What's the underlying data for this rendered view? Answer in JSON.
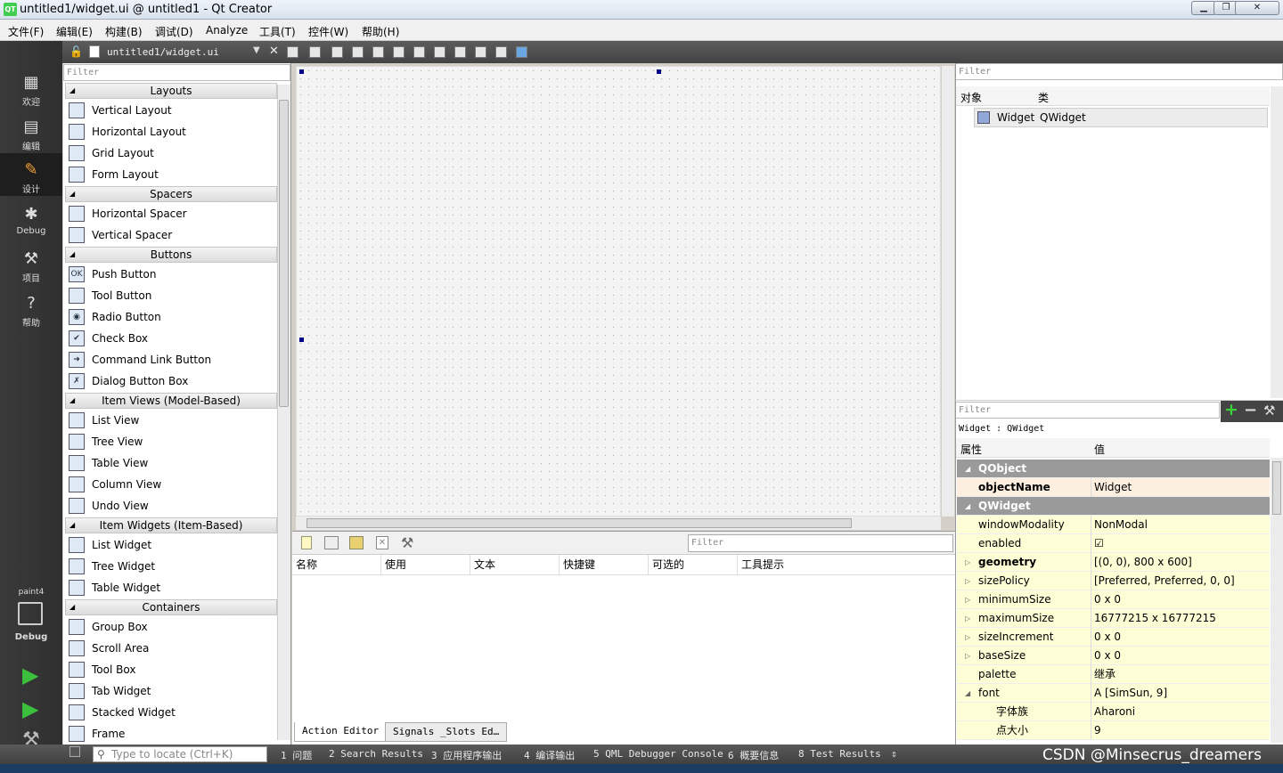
{
  "window": {
    "app_icon": "QT",
    "title": "untitled1/widget.ui @ untitled1 - Qt Creator"
  },
  "menu": [
    "文件(F)",
    "编辑(E)",
    "构建(B)",
    "调试(D)",
    "Analyze",
    "工具(T)",
    "控件(W)",
    "帮助(H)"
  ],
  "modes": [
    {
      "label": "欢迎",
      "icon": "grid-icon"
    },
    {
      "label": "编辑",
      "icon": "edit-doc-icon"
    },
    {
      "label": "设计",
      "icon": "pencil-icon"
    },
    {
      "label": "Debug",
      "icon": "bug-icon"
    },
    {
      "label": "项目",
      "icon": "wrench-icon"
    },
    {
      "label": "帮助",
      "icon": "help-icon"
    }
  ],
  "kit": {
    "project": "paint4",
    "build": "Debug"
  },
  "toolbar": {
    "file_name": "untitled1/widget.ui"
  },
  "widgetbox": {
    "filter_placeholder": "Filter",
    "sections": [
      {
        "title": "Layouts",
        "items": [
          "Vertical Layout",
          "Horizontal Layout",
          "Grid Layout",
          "Form Layout"
        ]
      },
      {
        "title": "Spacers",
        "items": [
          "Horizontal Spacer",
          "Vertical Spacer"
        ]
      },
      {
        "title": "Buttons",
        "items": [
          "Push Button",
          "Tool Button",
          "Radio Button",
          "Check Box",
          "Command Link Button",
          "Dialog Button Box"
        ]
      },
      {
        "title": "Item Views (Model-Based)",
        "items": [
          "List View",
          "Tree View",
          "Table View",
          "Column View",
          "Undo View"
        ]
      },
      {
        "title": "Item Widgets (Item-Based)",
        "items": [
          "List Widget",
          "Tree Widget",
          "Table Widget"
        ]
      },
      {
        "title": "Containers",
        "items": [
          "Group Box",
          "Scroll Area",
          "Tool Box",
          "Tab Widget",
          "Stacked Widget",
          "Frame"
        ]
      }
    ]
  },
  "action_editor": {
    "filter_placeholder": "Filter",
    "columns": [
      "名称",
      "使用",
      "文本",
      "快捷键",
      "可选的",
      "工具提示"
    ],
    "tabs": [
      "Action Editor",
      "Signals _Slots Ed…"
    ]
  },
  "object_inspector": {
    "filter_placeholder": "Filter",
    "columns": [
      "对象",
      "类"
    ],
    "rows": [
      {
        "object": "Widget",
        "class": "QWidget"
      }
    ]
  },
  "property_editor": {
    "filter_placeholder": "Filter",
    "caption": "Widget : QWidget",
    "columns": [
      "属性",
      "值"
    ],
    "rows": [
      {
        "key": "QObject",
        "value": "",
        "type": "group"
      },
      {
        "key": "objectName",
        "value": "Widget",
        "type": "obj",
        "bold": true
      },
      {
        "key": "QWidget",
        "value": "",
        "type": "group"
      },
      {
        "key": "windowModality",
        "value": "NonModal",
        "type": "yellow"
      },
      {
        "key": "enabled",
        "value": "☑",
        "type": "yellow"
      },
      {
        "key": "geometry",
        "value": "[(0, 0), 800 x 600]",
        "type": "yellow",
        "bold": true,
        "expandable": true
      },
      {
        "key": "sizePolicy",
        "value": "[Preferred, Preferred, 0, 0]",
        "type": "yellow",
        "expandable": true
      },
      {
        "key": "minimumSize",
        "value": "0 x 0",
        "type": "yellow",
        "expandable": true
      },
      {
        "key": "maximumSize",
        "value": "16777215 x 16777215",
        "type": "yellow",
        "expandable": true
      },
      {
        "key": "sizeIncrement",
        "value": "0 x 0",
        "type": "yellow",
        "expandable": true
      },
      {
        "key": "baseSize",
        "value": "0 x 0",
        "type": "yellow",
        "expandable": true
      },
      {
        "key": "palette",
        "value": "继承",
        "type": "yellow"
      },
      {
        "key": "font",
        "value": "A  [SimSun, 9]",
        "type": "yellow",
        "expanded": true
      },
      {
        "key": "字体族",
        "value": "Aharoni",
        "type": "yellow",
        "sub": true
      },
      {
        "key": "点大小",
        "value": "9",
        "type": "yellow",
        "sub": true
      }
    ]
  },
  "statusbar": {
    "locator_placeholder": "Type to locate (Ctrl+K)",
    "panes": [
      "1 问题",
      "2 Search Results",
      "3 应用程序输出",
      "4 编译输出",
      "5 QML Debugger Console",
      "6 概要信息",
      "8 Test Results"
    ]
  },
  "watermark": "CSDN @Minsecrus_dreamers"
}
